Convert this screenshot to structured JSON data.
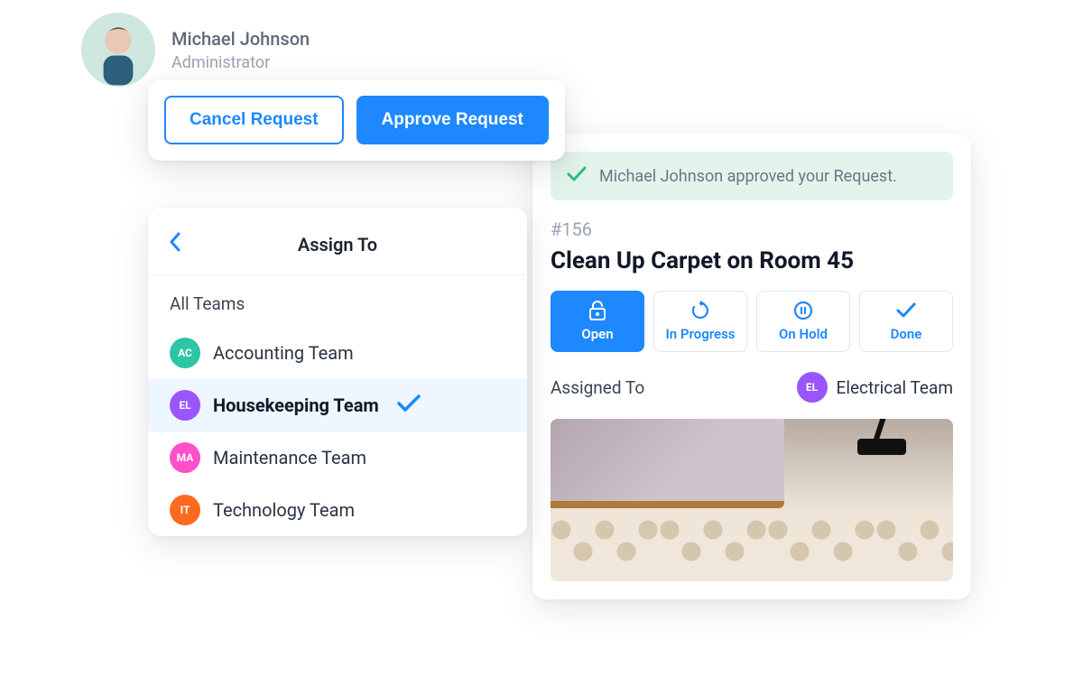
{
  "user": {
    "name": "Michael Johnson",
    "role": "Administrator"
  },
  "actions": {
    "cancel": "Cancel Request",
    "approve": "Approve Request"
  },
  "assign": {
    "title": "Assign To",
    "all_teams": "All Teams",
    "teams": [
      {
        "initials": "AC",
        "name": "Accounting Team",
        "color": "#2ec4a6",
        "selected": false
      },
      {
        "initials": "EL",
        "name": "Housekeeping Team",
        "color": "#9a55ff",
        "selected": true
      },
      {
        "initials": "MA",
        "name": "Maintenance Team",
        "color": "#ff4fc9",
        "selected": false
      },
      {
        "initials": "IT",
        "name": "Technology Team",
        "color": "#ff6a1f",
        "selected": false
      }
    ]
  },
  "request": {
    "approved_message": "Michael Johnson approved your Request.",
    "id": "#156",
    "title": "Clean Up Carpet on Room 45",
    "statuses": [
      {
        "key": "open",
        "label": "Open",
        "active": true
      },
      {
        "key": "in_progress",
        "label": "In Progress",
        "active": false
      },
      {
        "key": "on_hold",
        "label": "On Hold",
        "active": false
      },
      {
        "key": "done",
        "label": "Done",
        "active": false
      }
    ],
    "assigned_to_label": "Assigned To",
    "assigned_team": {
      "initials": "EL",
      "name": "Electrical Team",
      "color": "#9a55ff"
    }
  }
}
